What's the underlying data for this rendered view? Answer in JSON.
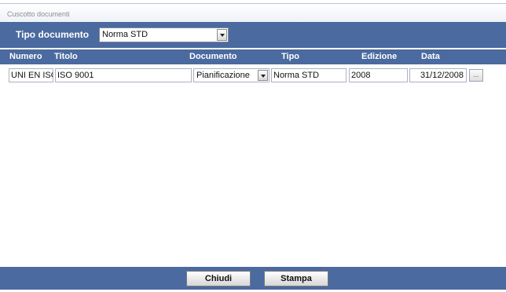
{
  "window": {
    "title": "Cuscotto documenti"
  },
  "filter": {
    "label": "Tipo documento",
    "selected": "Norma STD"
  },
  "table": {
    "headers": {
      "numero": "Numero",
      "titolo": "Titolo",
      "documento": "Documento",
      "tipo": "Tipo",
      "edizione": "Edizione",
      "data": "Data"
    },
    "row": {
      "numero": "UNI EN ISO",
      "titolo": "ISO 9001",
      "documento": "Pianificazione",
      "tipo": "Norma STD",
      "edizione": "2008",
      "data": "31/12/2008",
      "more_button": "..."
    }
  },
  "footer": {
    "close_label": "Chiudi",
    "print_label": "Stampa"
  },
  "colors": {
    "header_blue": "#4a6aa0"
  }
}
